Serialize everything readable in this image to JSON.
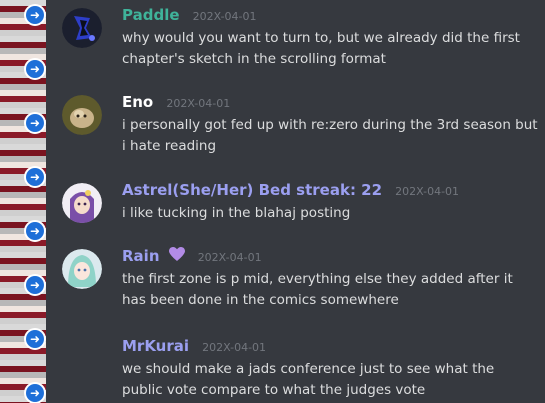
{
  "messages": [
    {
      "username": "Paddle",
      "user_color": "#3fb39a",
      "timestamp": "202X-04-01",
      "text": "why would you want to turn to, but we already did the first chapter's sketch in the scrolling format"
    },
    {
      "username": "Eno",
      "user_color": "#ffffff",
      "timestamp": "202X-04-01",
      "text": "i personally got fed up with re:zero during the 3rd season but i hate reading"
    },
    {
      "username": "Astrel(She/Her) Bed streak: 22",
      "user_color": "#9b9ff0",
      "timestamp": "202X-04-01",
      "text": "i like tucking in the blahaj posting"
    },
    {
      "username": "Rain",
      "user_color": "#9b9ff0",
      "timestamp": "202X-04-01",
      "text": "the first zone is p mid, everything else they added after it has been done in the comics somewhere",
      "badge_icon": "purple-heart-icon"
    },
    {
      "username": "MrKurai",
      "user_color": "#9b9ff0",
      "timestamp": "202X-04-01",
      "text": "we should make a jads conference just to see what the public vote compare to what the judges vote"
    }
  ],
  "colors": {
    "background": "#36393f",
    "text": "#dcddde",
    "timestamp": "#72767d",
    "heart": "#b28be6"
  }
}
